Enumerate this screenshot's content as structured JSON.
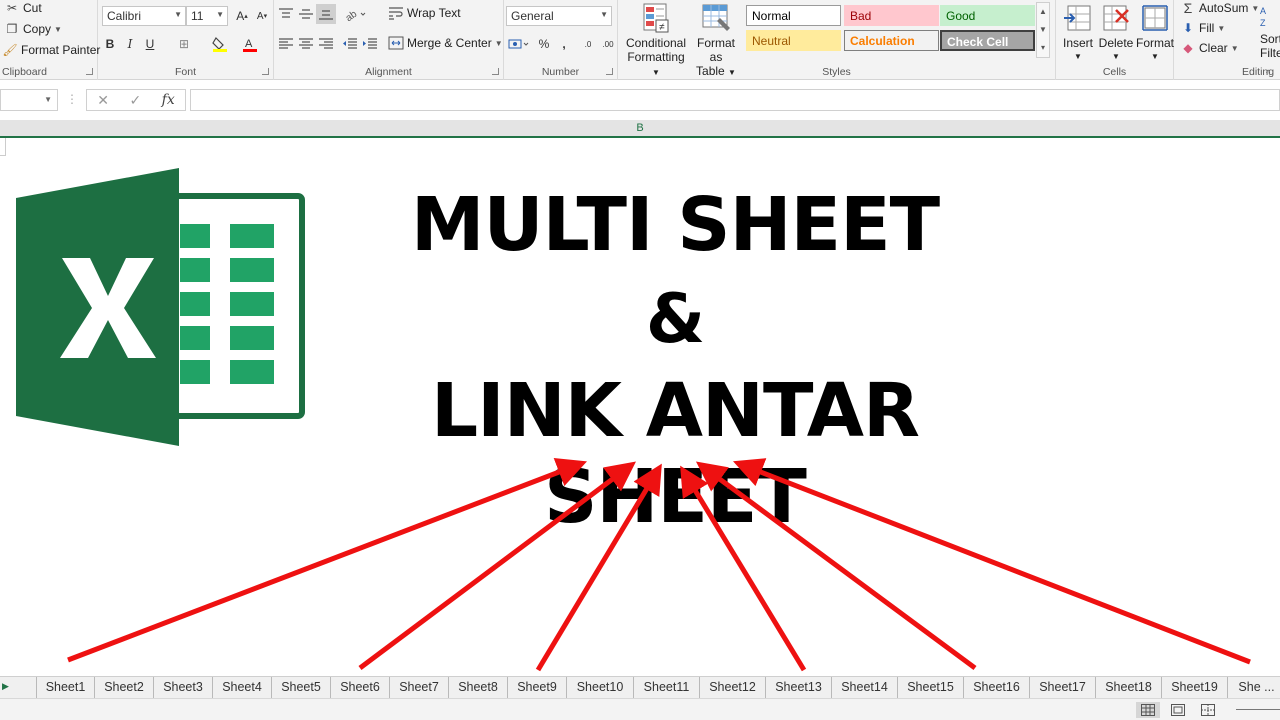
{
  "ribbon": {
    "clipboard": {
      "cut": "Cut",
      "copy": "Copy",
      "format_painter": "Format Painter",
      "label": "Clipboard"
    },
    "font": {
      "name": "Calibri",
      "size": "11",
      "label": "Font",
      "bold": "B",
      "italic": "I",
      "underline": "U",
      "grow": "A",
      "shrink": "A",
      "font_color": "A"
    },
    "alignment": {
      "wrap_text": "Wrap Text",
      "merge_center": "Merge & Center",
      "label": "Alignment"
    },
    "number": {
      "format": "General",
      "percent": "%",
      "comma": ",",
      "inc_decimal": ".0",
      "dec_decimal": ".00",
      "label": "Number"
    },
    "styles": {
      "conditional_line1": "Conditional",
      "conditional_line2": "Formatting",
      "format_table_line1": "Format as",
      "format_table_line2": "Table",
      "cells": [
        {
          "label": "Normal",
          "bg": "#ffffff",
          "fg": "#000000",
          "border": "#9a9a9a"
        },
        {
          "label": "Bad",
          "bg": "#ffc7ce",
          "fg": "#9c0006",
          "border": "#ffc7ce"
        },
        {
          "label": "Good",
          "bg": "#c6efce",
          "fg": "#006100",
          "border": "#c6efce"
        },
        {
          "label": "Neutral",
          "bg": "#ffeb9c",
          "fg": "#9c5700",
          "border": "#ffeb9c"
        },
        {
          "label": "Calculation",
          "bg": "#f2f2f2",
          "fg": "#fa7d00",
          "border": "#7f7f7f"
        },
        {
          "label": "Check Cell",
          "bg": "#a5a5a5",
          "fg": "#ffffff",
          "border": "#3f3f3f"
        }
      ],
      "label": "Styles"
    },
    "cells": {
      "insert": "Insert",
      "delete": "Delete",
      "format": "Format",
      "label": "Cells"
    },
    "editing": {
      "autosum": "AutoSum",
      "fill": "Fill",
      "clear": "Clear",
      "sort_line1": "Sort",
      "sort_line2": "Filte",
      "label": "Editing"
    }
  },
  "formula_bar": {
    "fx": "fx",
    "cancel": "✕",
    "enter": "✓"
  },
  "grid": {
    "column_header": "B"
  },
  "content": {
    "line1": "MULTI SHEET",
    "line2": "&",
    "line3": "LINK ANTAR SHEET"
  },
  "colors": {
    "excel_green": "#217346",
    "arrow_red": "#ee1111",
    "logo_dark": "#1d6f42",
    "logo_mid": "#21a366",
    "logo_light": "#33c481"
  },
  "sheets": [
    "Sheet1",
    "Sheet2",
    "Sheet3",
    "Sheet4",
    "Sheet5",
    "Sheet6",
    "Sheet7",
    "Sheet8",
    "Sheet9",
    "Sheet10",
    "Sheet11",
    "Sheet12",
    "Sheet13",
    "Sheet14",
    "Sheet15",
    "Sheet16",
    "Sheet17",
    "Sheet18",
    "Sheet19",
    "She ..."
  ]
}
